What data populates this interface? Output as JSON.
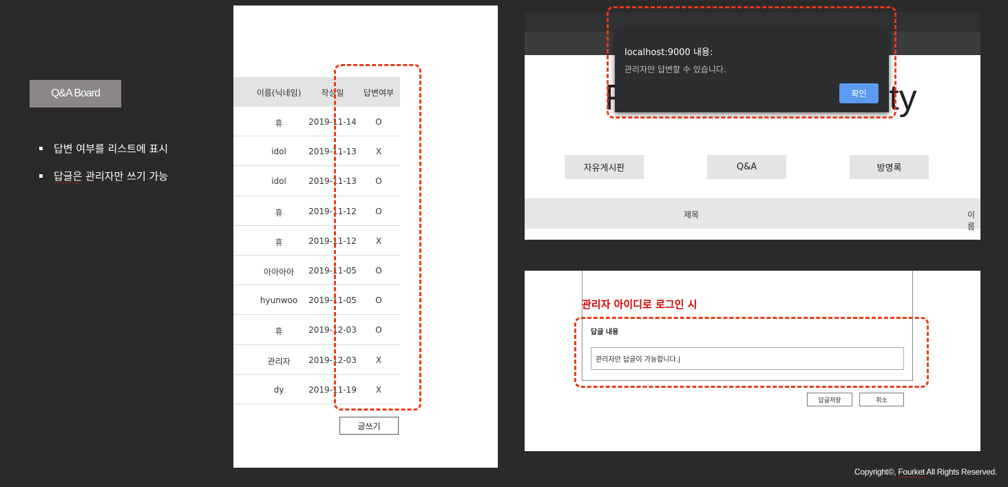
{
  "badge": {
    "label": "Q&A Board"
  },
  "bullets": [
    {
      "text": "답변 여부를 리스트에 표시"
    },
    {
      "text_underlined": "답글은",
      "text_rest": " 관리자만 쓰기 가능"
    }
  ],
  "board": {
    "headers": {
      "name": "이름(닉네임)",
      "date": "작성일",
      "answered": "답변여부"
    },
    "rows": [
      {
        "name": "휴",
        "date": "2019-11-14",
        "answered": "O"
      },
      {
        "name": "idol",
        "date": "2019-11-13",
        "answered": "X"
      },
      {
        "name": "idol",
        "date": "2019-11-13",
        "answered": "O"
      },
      {
        "name": "휴",
        "date": "2019-11-12",
        "answered": "O"
      },
      {
        "name": "휴",
        "date": "2019-11-12",
        "answered": "X"
      },
      {
        "name": "아아아아",
        "date": "2019-11-05",
        "answered": "O"
      },
      {
        "name": "hyunwoo",
        "date": "2019-11-05",
        "answered": "O"
      },
      {
        "name": "휴",
        "date": "2019-12-03",
        "answered": "O"
      },
      {
        "name": "관리자",
        "date": "2019-12-03",
        "answered": "X"
      },
      {
        "name": "dy",
        "date": "2019-11-19",
        "answered": "X"
      }
    ],
    "write_button": "글쓰기"
  },
  "alert": {
    "title": "localhost:9000 내용:",
    "message": "관리자만 답변할 수 있습니다.",
    "ok": "확인",
    "hero": "Fourket Community",
    "menu": [
      "자유게시판",
      "Q&A",
      "방명록"
    ],
    "bar_title": "제목",
    "bar_name": "이름"
  },
  "reply": {
    "caption": "관리자 아이디로 로그인 시",
    "label": "답글 내용",
    "input_value": "관리자만 답글이 가능합니다.|",
    "save": "답글저장",
    "cancel": "취소"
  },
  "footer": {
    "prefix": "Copyright©, ",
    "brand": "Fourket",
    "suffix": " All Rights Reserved."
  },
  "colors": {
    "highlight": "#ea3c17",
    "dialog_ok": "#5b9bf0",
    "caption": "#d40000"
  }
}
